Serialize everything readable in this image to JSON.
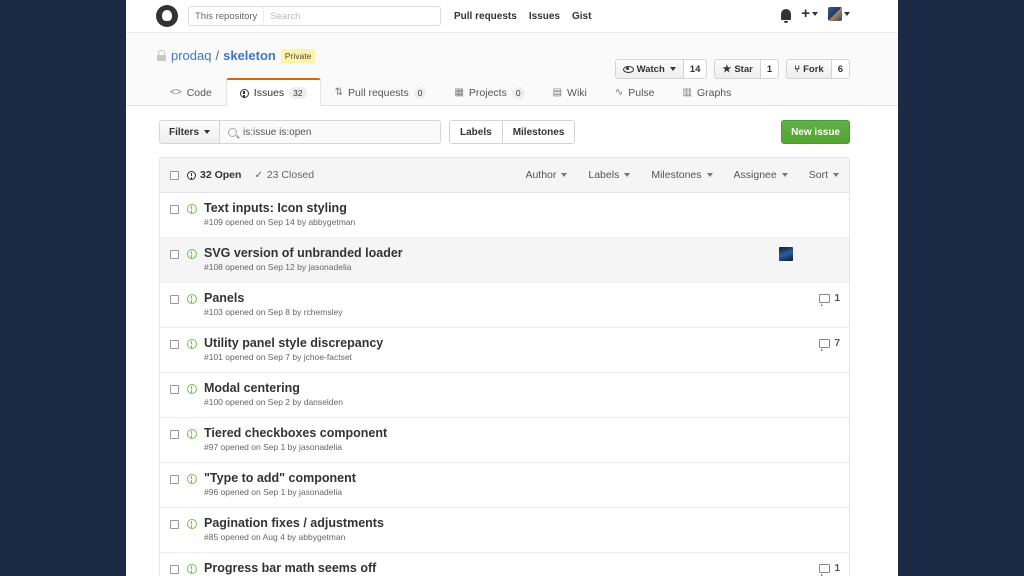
{
  "header": {
    "search_scope": "This repository",
    "search_placeholder": "Search",
    "nav": [
      "Pull requests",
      "Issues",
      "Gist"
    ]
  },
  "repo": {
    "owner": "prodaq",
    "separator": "/",
    "name": "skeleton",
    "visibility": "Private",
    "watch": {
      "label": "Watch",
      "count": "14"
    },
    "star": {
      "label": "Star",
      "count": "1"
    },
    "fork": {
      "label": "Fork",
      "count": "6"
    },
    "tabs": [
      {
        "label": "Code",
        "icon": "code-icon",
        "count": ""
      },
      {
        "label": "Issues",
        "icon": "issue-icon",
        "count": "32"
      },
      {
        "label": "Pull requests",
        "icon": "pull-request-icon",
        "count": "0"
      },
      {
        "label": "Projects",
        "icon": "project-icon",
        "count": "0"
      },
      {
        "label": "Wiki",
        "icon": "book-icon",
        "count": ""
      },
      {
        "label": "Pulse",
        "icon": "pulse-icon",
        "count": ""
      },
      {
        "label": "Graphs",
        "icon": "graph-icon",
        "count": ""
      }
    ]
  },
  "subnav": {
    "filters_label": "Filters",
    "filter_value": "is:issue is:open",
    "labels_label": "Labels",
    "milestones_label": "Milestones",
    "new_issue_label": "New issue"
  },
  "issues": {
    "open_label": "32 Open",
    "closed_label": "23 Closed",
    "filters": [
      "Author",
      "Labels",
      "Milestones",
      "Assignee",
      "Sort"
    ],
    "rows": [
      {
        "title": "Text inputs: Icon styling",
        "meta": "#109 opened on Sep 14 by abbygetman",
        "comments": ""
      },
      {
        "title": "SVG version of unbranded loader",
        "meta": "#108 opened on Sep 12 by jasonadelia",
        "comments": ""
      },
      {
        "title": "Panels",
        "meta": "#103 opened on Sep 8 by rchemsley",
        "comments": "1"
      },
      {
        "title": "Utility panel style discrepancy",
        "meta": "#101 opened on Sep 7 by jchoe-factset",
        "comments": "7"
      },
      {
        "title": "Modal centering",
        "meta": "#100 opened on Sep 2 by danselden",
        "comments": ""
      },
      {
        "title": "Tiered checkboxes component",
        "meta": "#97 opened on Sep 1 by jasonadelia",
        "comments": ""
      },
      {
        "title": "\"Type to add\" component",
        "meta": "#96 opened on Sep 1 by jasonadelia",
        "comments": ""
      },
      {
        "title": "Pagination fixes / adjustments",
        "meta": "#85 opened on Aug 4 by abbygetman",
        "comments": ""
      },
      {
        "title": "Progress bar math seems off",
        "meta": "",
        "comments": "1"
      }
    ]
  },
  "colors": {
    "accent": "#4078c0",
    "open": "#6cc644",
    "new_issue": "#55a532",
    "tab_active": "#d26911",
    "background": "#1b2a45"
  }
}
